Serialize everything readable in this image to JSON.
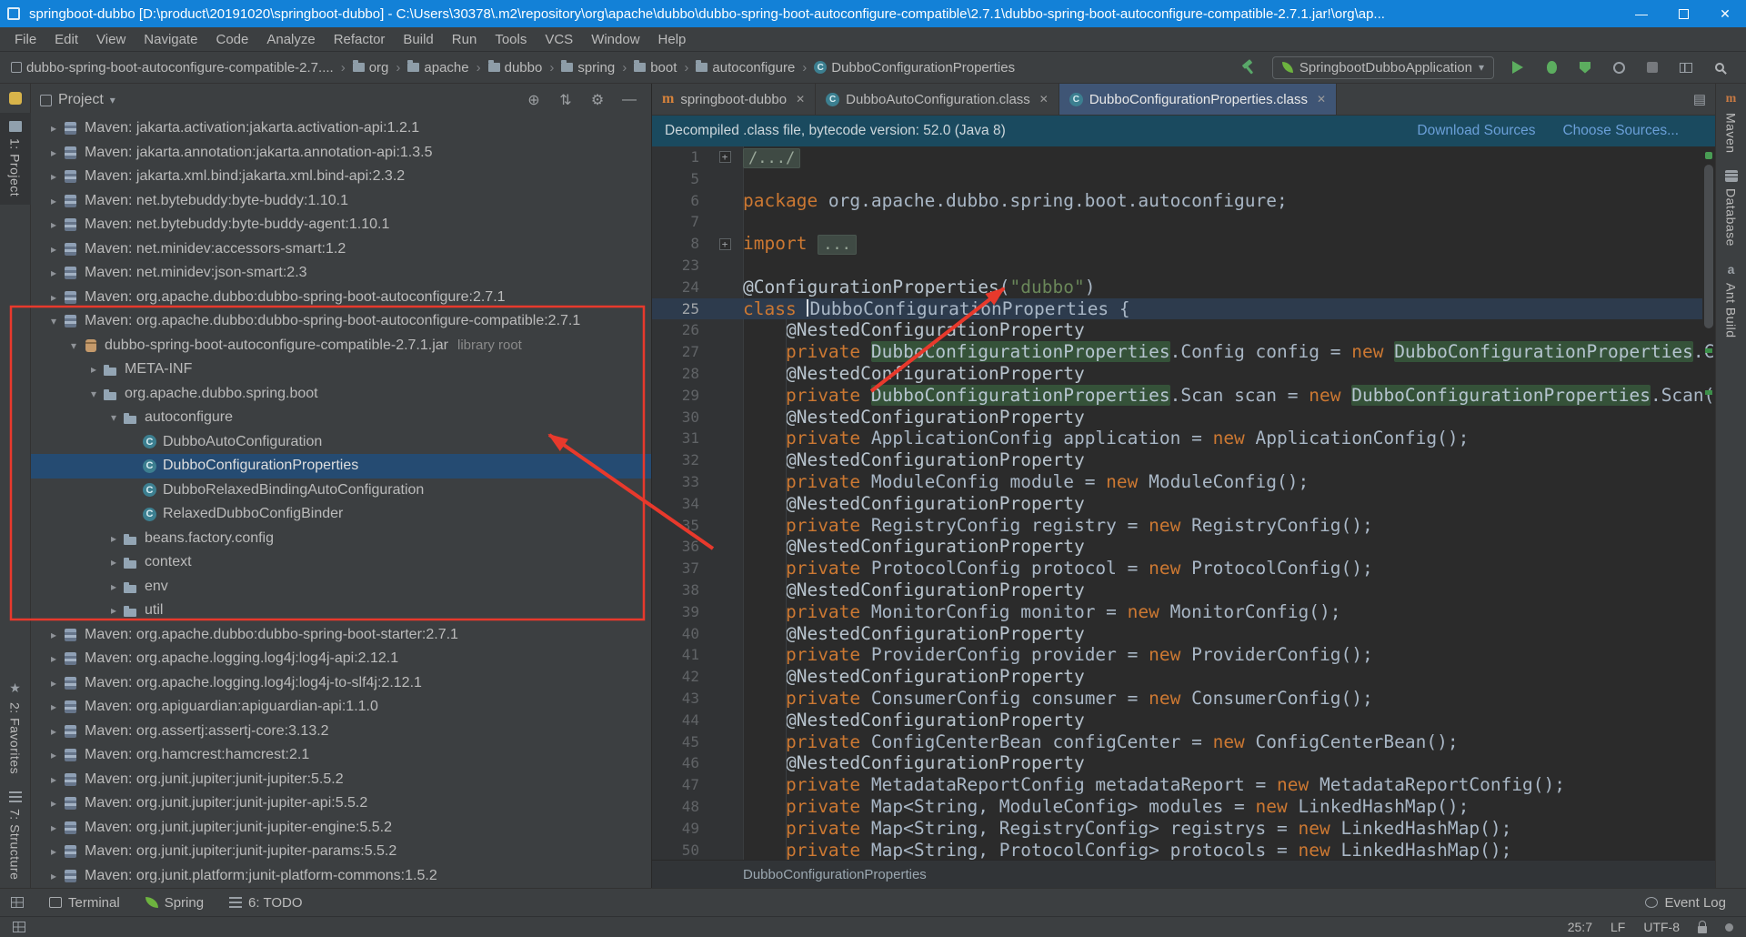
{
  "colors": {
    "titlebar_blue": "#1381d7",
    "selection_blue": "#254b72",
    "annotation_red": "#e8392c",
    "keyword_orange": "#cc7832",
    "string_green": "#6a8759",
    "occurrence_highlight_green": "#355239",
    "run_green": "#5cad5f",
    "link_blue": "#6a9fd8"
  },
  "title_bar": {
    "title": "springboot-dubbo [D:\\product\\20191020\\springboot-dubbo] - C:\\Users\\30378\\.m2\\repository\\org\\apache\\dubbo\\dubbo-spring-boot-autoconfigure-compatible\\2.7.1\\dubbo-spring-boot-autoconfigure-compatible-2.7.1.jar!\\org\\ap...",
    "minimize": "—",
    "close": "✕"
  },
  "menu_bar": {
    "items": [
      "File",
      "Edit",
      "View",
      "Navigate",
      "Code",
      "Analyze",
      "Refactor",
      "Build",
      "Run",
      "Tools",
      "VCS",
      "Window",
      "Help"
    ]
  },
  "nav_bar": {
    "crumbs": [
      {
        "label": "dubbo-spring-boot-autoconfigure-compatible-2.7....",
        "icon": "module"
      },
      {
        "label": "org",
        "icon": "folder"
      },
      {
        "label": "apache",
        "icon": "folder"
      },
      {
        "label": "dubbo",
        "icon": "folder"
      },
      {
        "label": "spring",
        "icon": "folder"
      },
      {
        "label": "boot",
        "icon": "folder"
      },
      {
        "label": "autoconfigure",
        "icon": "folder"
      },
      {
        "label": "DubboConfigurationProperties",
        "icon": "class"
      }
    ],
    "run_config": "SpringbootDubboApplication"
  },
  "left_stripe": {
    "top": [
      {
        "icon": "learn",
        "label": ""
      },
      {
        "icon": "project-folder",
        "label": "1: Project",
        "active": true
      }
    ],
    "bottom": [
      {
        "icon": "favorites-star",
        "label": "2: Favorites"
      },
      {
        "icon": "structure",
        "label": "7: Structure"
      }
    ]
  },
  "right_stripe": {
    "items": [
      {
        "icon": "maven",
        "label": "Maven"
      },
      {
        "icon": "database",
        "label": "Database"
      },
      {
        "icon": "ant",
        "label": "Ant Build"
      }
    ]
  },
  "project_panel": {
    "header": "Project",
    "tree": [
      {
        "indent": 0,
        "arrow": "c",
        "icon": "lib",
        "label": "Maven: jakarta.activation:jakarta.activation-api:1.2.1"
      },
      {
        "indent": 0,
        "arrow": "c",
        "icon": "lib",
        "label": "Maven: jakarta.annotation:jakarta.annotation-api:1.3.5"
      },
      {
        "indent": 0,
        "arrow": "c",
        "icon": "lib",
        "label": "Maven: jakarta.xml.bind:jakarta.xml.bind-api:2.3.2"
      },
      {
        "indent": 0,
        "arrow": "c",
        "icon": "lib",
        "label": "Maven: net.bytebuddy:byte-buddy:1.10.1"
      },
      {
        "indent": 0,
        "arrow": "c",
        "icon": "lib",
        "label": "Maven: net.bytebuddy:byte-buddy-agent:1.10.1"
      },
      {
        "indent": 0,
        "arrow": "c",
        "icon": "lib",
        "label": "Maven: net.minidev:accessors-smart:1.2"
      },
      {
        "indent": 0,
        "arrow": "c",
        "icon": "lib",
        "label": "Maven: net.minidev:json-smart:2.3"
      },
      {
        "indent": 0,
        "arrow": "c",
        "icon": "lib",
        "label": "Maven: org.apache.dubbo:dubbo-spring-boot-autoconfigure:2.7.1"
      },
      {
        "indent": 0,
        "arrow": "o",
        "icon": "lib",
        "label": "Maven: org.apache.dubbo:dubbo-spring-boot-autoconfigure-compatible:2.7.1"
      },
      {
        "indent": 1,
        "arrow": "o",
        "icon": "jar",
        "label": "dubbo-spring-boot-autoconfigure-compatible-2.7.1.jar",
        "suffix": "library root"
      },
      {
        "indent": 2,
        "arrow": "c",
        "icon": "pkg",
        "label": "META-INF"
      },
      {
        "indent": 2,
        "arrow": "o",
        "icon": "pkg",
        "label": "org.apache.dubbo.spring.boot"
      },
      {
        "indent": 3,
        "arrow": "o",
        "icon": "pkg",
        "label": "autoconfigure"
      },
      {
        "indent": 4,
        "arrow": null,
        "icon": "class",
        "label": "DubboAutoConfiguration"
      },
      {
        "indent": 4,
        "arrow": null,
        "icon": "class",
        "label": "DubboConfigurationProperties",
        "selected": true
      },
      {
        "indent": 4,
        "arrow": null,
        "icon": "class",
        "label": "DubboRelaxedBindingAutoConfiguration"
      },
      {
        "indent": 4,
        "arrow": null,
        "icon": "class",
        "label": "RelaxedDubboConfigBinder"
      },
      {
        "indent": 3,
        "arrow": "c",
        "icon": "pkg",
        "label": "beans.factory.config"
      },
      {
        "indent": 3,
        "arrow": "c",
        "icon": "pkg",
        "label": "context"
      },
      {
        "indent": 3,
        "arrow": "c",
        "icon": "pkg",
        "label": "env"
      },
      {
        "indent": 3,
        "arrow": "c",
        "icon": "pkg",
        "label": "util"
      },
      {
        "indent": 0,
        "arrow": "c",
        "icon": "lib",
        "label": "Maven: org.apache.dubbo:dubbo-spring-boot-starter:2.7.1"
      },
      {
        "indent": 0,
        "arrow": "c",
        "icon": "lib",
        "label": "Maven: org.apache.logging.log4j:log4j-api:2.12.1"
      },
      {
        "indent": 0,
        "arrow": "c",
        "icon": "lib",
        "label": "Maven: org.apache.logging.log4j:log4j-to-slf4j:2.12.1"
      },
      {
        "indent": 0,
        "arrow": "c",
        "icon": "lib",
        "label": "Maven: org.apiguardian:apiguardian-api:1.1.0"
      },
      {
        "indent": 0,
        "arrow": "c",
        "icon": "lib",
        "label": "Maven: org.assertj:assertj-core:3.13.2"
      },
      {
        "indent": 0,
        "arrow": "c",
        "icon": "lib",
        "label": "Maven: org.hamcrest:hamcrest:2.1"
      },
      {
        "indent": 0,
        "arrow": "c",
        "icon": "lib",
        "label": "Maven: org.junit.jupiter:junit-jupiter:5.5.2"
      },
      {
        "indent": 0,
        "arrow": "c",
        "icon": "lib",
        "label": "Maven: org.junit.jupiter:junit-jupiter-api:5.5.2"
      },
      {
        "indent": 0,
        "arrow": "c",
        "icon": "lib",
        "label": "Maven: org.junit.jupiter:junit-jupiter-engine:5.5.2"
      },
      {
        "indent": 0,
        "arrow": "c",
        "icon": "lib",
        "label": "Maven: org.junit.jupiter:junit-jupiter-params:5.5.2"
      },
      {
        "indent": 0,
        "arrow": "c",
        "icon": "lib",
        "label": "Maven: org.junit.platform:junit-platform-commons:1.5.2"
      }
    ]
  },
  "editor": {
    "tabs": [
      {
        "icon": "maven",
        "label": "springboot-dubbo"
      },
      {
        "icon": "class",
        "label": "DubboAutoConfiguration.class"
      },
      {
        "icon": "class",
        "label": "DubboConfigurationProperties.class",
        "active": true
      }
    ],
    "banner": {
      "text": "Decompiled .class file, bytecode version: 52.0 (Java 8)",
      "links": [
        "Download Sources",
        "Choose Sources..."
      ]
    },
    "breadcrumb": "DubboConfigurationProperties",
    "lines": [
      {
        "num": "1",
        "fold": true,
        "segs": [
          [
            "fold",
            "/.../"
          ]
        ]
      },
      {
        "num": "5",
        "segs": []
      },
      {
        "num": "6",
        "segs": [
          [
            "k",
            "package "
          ],
          [
            "t",
            "org.apache.dubbo.spring.boot.autoconfigure;"
          ]
        ]
      },
      {
        "num": "7",
        "segs": []
      },
      {
        "num": "8",
        "fold": true,
        "segs": [
          [
            "k",
            "import "
          ],
          [
            "fold",
            "..."
          ]
        ]
      },
      {
        "num": "23",
        "segs": []
      },
      {
        "num": "24",
        "segs": [
          [
            "ann",
            "@ConfigurationProperties"
          ],
          [
            "t",
            "("
          ],
          [
            "s",
            "\"dubbo\""
          ],
          [
            "t",
            ")"
          ]
        ]
      },
      {
        "num": "25",
        "current": true,
        "segs": [
          [
            "k",
            "class "
          ],
          [
            "caret",
            ""
          ],
          [
            "t",
            "DubboConfigurationProperties {"
          ]
        ]
      },
      {
        "num": "26",
        "segs": [
          [
            "t",
            "    "
          ],
          [
            "ann",
            "@NestedConfigurationProperty"
          ]
        ]
      },
      {
        "num": "27",
        "segs": [
          [
            "t",
            "    "
          ],
          [
            "k",
            "private "
          ],
          [
            "hl",
            "DubboConfigurationProperties"
          ],
          [
            "t",
            ".Config config = "
          ],
          [
            "k",
            "new "
          ],
          [
            "hl",
            "DubboConfigurationProperties"
          ],
          [
            "t",
            ".Config();"
          ]
        ]
      },
      {
        "num": "28",
        "segs": [
          [
            "t",
            "    "
          ],
          [
            "ann",
            "@NestedConfigurationProperty"
          ]
        ]
      },
      {
        "num": "29",
        "segs": [
          [
            "t",
            "    "
          ],
          [
            "k",
            "private "
          ],
          [
            "hl",
            "DubboConfigurationProperties"
          ],
          [
            "t",
            ".Scan scan = "
          ],
          [
            "k",
            "new "
          ],
          [
            "hl",
            "DubboConfigurationProperties"
          ],
          [
            "t",
            ".Scan();"
          ]
        ]
      },
      {
        "num": "30",
        "segs": [
          [
            "t",
            "    "
          ],
          [
            "ann",
            "@NestedConfigurationProperty"
          ]
        ]
      },
      {
        "num": "31",
        "segs": [
          [
            "t",
            "    "
          ],
          [
            "k",
            "private "
          ],
          [
            "t",
            "ApplicationConfig application = "
          ],
          [
            "k",
            "new "
          ],
          [
            "t",
            "ApplicationConfig();"
          ]
        ]
      },
      {
        "num": "32",
        "segs": [
          [
            "t",
            "    "
          ],
          [
            "ann",
            "@NestedConfigurationProperty"
          ]
        ]
      },
      {
        "num": "33",
        "segs": [
          [
            "t",
            "    "
          ],
          [
            "k",
            "private "
          ],
          [
            "t",
            "ModuleConfig module = "
          ],
          [
            "k",
            "new "
          ],
          [
            "t",
            "ModuleConfig();"
          ]
        ]
      },
      {
        "num": "34",
        "segs": [
          [
            "t",
            "    "
          ],
          [
            "ann",
            "@NestedConfigurationProperty"
          ]
        ]
      },
      {
        "num": "35",
        "segs": [
          [
            "t",
            "    "
          ],
          [
            "k",
            "private "
          ],
          [
            "t",
            "RegistryConfig registry = "
          ],
          [
            "k",
            "new "
          ],
          [
            "t",
            "RegistryConfig();"
          ]
        ]
      },
      {
        "num": "36",
        "segs": [
          [
            "t",
            "    "
          ],
          [
            "ann",
            "@NestedConfigurationProperty"
          ]
        ]
      },
      {
        "num": "37",
        "segs": [
          [
            "t",
            "    "
          ],
          [
            "k",
            "private "
          ],
          [
            "t",
            "ProtocolConfig protocol = "
          ],
          [
            "k",
            "new "
          ],
          [
            "t",
            "ProtocolConfig();"
          ]
        ]
      },
      {
        "num": "38",
        "segs": [
          [
            "t",
            "    "
          ],
          [
            "ann",
            "@NestedConfigurationProperty"
          ]
        ]
      },
      {
        "num": "39",
        "segs": [
          [
            "t",
            "    "
          ],
          [
            "k",
            "private "
          ],
          [
            "t",
            "MonitorConfig monitor = "
          ],
          [
            "k",
            "new "
          ],
          [
            "t",
            "MonitorConfig();"
          ]
        ]
      },
      {
        "num": "40",
        "segs": [
          [
            "t",
            "    "
          ],
          [
            "ann",
            "@NestedConfigurationProperty"
          ]
        ]
      },
      {
        "num": "41",
        "segs": [
          [
            "t",
            "    "
          ],
          [
            "k",
            "private "
          ],
          [
            "t",
            "ProviderConfig provider = "
          ],
          [
            "k",
            "new "
          ],
          [
            "t",
            "ProviderConfig();"
          ]
        ]
      },
      {
        "num": "42",
        "segs": [
          [
            "t",
            "    "
          ],
          [
            "ann",
            "@NestedConfigurationProperty"
          ]
        ]
      },
      {
        "num": "43",
        "segs": [
          [
            "t",
            "    "
          ],
          [
            "k",
            "private "
          ],
          [
            "t",
            "ConsumerConfig consumer = "
          ],
          [
            "k",
            "new "
          ],
          [
            "t",
            "ConsumerConfig();"
          ]
        ]
      },
      {
        "num": "44",
        "segs": [
          [
            "t",
            "    "
          ],
          [
            "ann",
            "@NestedConfigurationProperty"
          ]
        ]
      },
      {
        "num": "45",
        "segs": [
          [
            "t",
            "    "
          ],
          [
            "k",
            "private "
          ],
          [
            "t",
            "ConfigCenterBean configCenter = "
          ],
          [
            "k",
            "new "
          ],
          [
            "t",
            "ConfigCenterBean();"
          ]
        ]
      },
      {
        "num": "46",
        "segs": [
          [
            "t",
            "    "
          ],
          [
            "ann",
            "@NestedConfigurationProperty"
          ]
        ]
      },
      {
        "num": "47",
        "segs": [
          [
            "t",
            "    "
          ],
          [
            "k",
            "private "
          ],
          [
            "t",
            "MetadataReportConfig metadataReport = "
          ],
          [
            "k",
            "new "
          ],
          [
            "t",
            "MetadataReportConfig();"
          ]
        ]
      },
      {
        "num": "48",
        "segs": [
          [
            "t",
            "    "
          ],
          [
            "k",
            "private "
          ],
          [
            "t",
            "Map<String, ModuleConfig> modules = "
          ],
          [
            "k",
            "new "
          ],
          [
            "t",
            "LinkedHashMap();"
          ]
        ]
      },
      {
        "num": "49",
        "segs": [
          [
            "t",
            "    "
          ],
          [
            "k",
            "private "
          ],
          [
            "t",
            "Map<String, RegistryConfig> registrys = "
          ],
          [
            "k",
            "new "
          ],
          [
            "t",
            "LinkedHashMap();"
          ]
        ]
      },
      {
        "num": "50",
        "segs": [
          [
            "t",
            "    "
          ],
          [
            "k",
            "private "
          ],
          [
            "t",
            "Map<String, ProtocolConfig> protocols = "
          ],
          [
            "k",
            "new "
          ],
          [
            "t",
            "LinkedHashMap();"
          ]
        ]
      }
    ]
  },
  "bottom_bar": {
    "left": [
      {
        "icon": "grid",
        "label": ""
      },
      {
        "icon": "terminal",
        "label": "Terminal"
      },
      {
        "icon": "spring",
        "label": "Spring"
      },
      {
        "icon": "todo",
        "label": "6: TODO"
      }
    ],
    "right": [
      {
        "icon": "eventlog",
        "label": "Event Log"
      }
    ]
  },
  "status_bar": {
    "caret_position": "25:7",
    "line_separator": "LF",
    "encoding": "UTF-8"
  }
}
